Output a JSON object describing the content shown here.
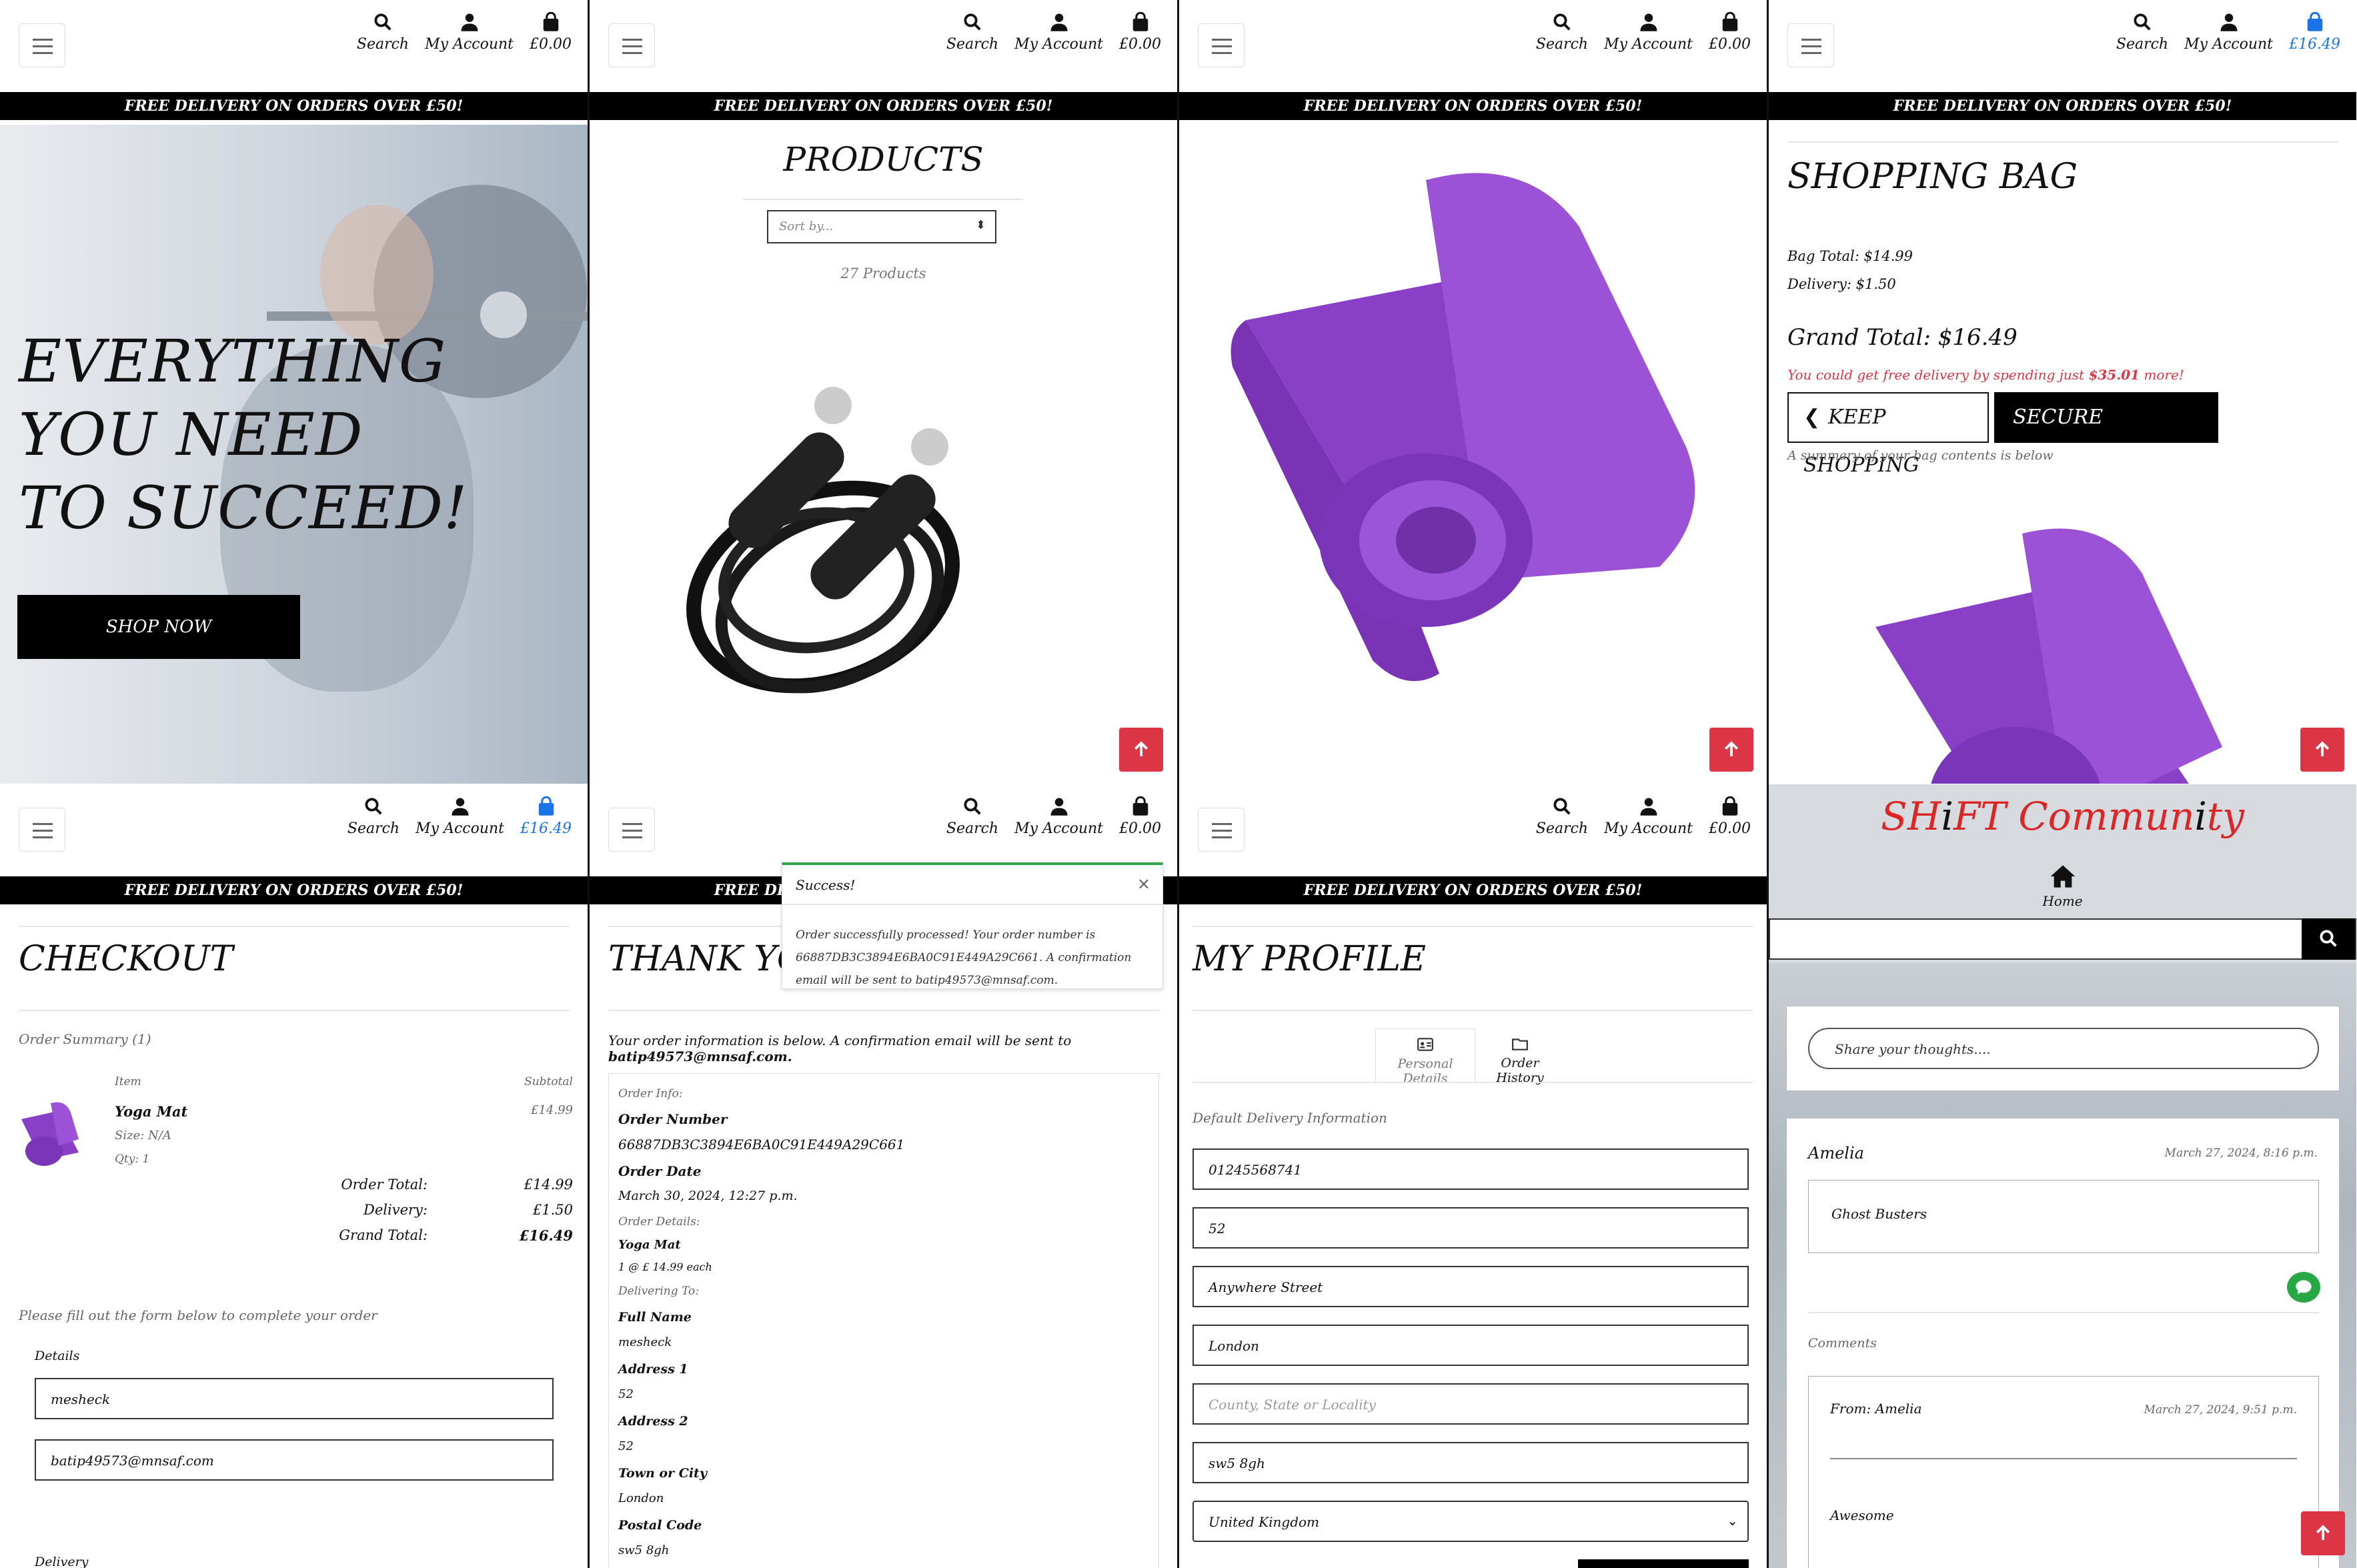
{
  "header": {
    "search_label": "Search",
    "account_label": "My Account",
    "bag_empty": "£0.00",
    "bag_filled": "£16.49",
    "banner": "FREE DELIVERY ON ORDERS OVER £50!"
  },
  "home": {
    "hero_lines": [
      "EVERYTHING",
      "YOU NEED",
      "TO SUCCEED!"
    ],
    "cta": "SHOP NOW"
  },
  "products": {
    "title": "PRODUCTS",
    "sort_placeholder": "Sort by...",
    "count": "27 Products"
  },
  "bag": {
    "title": "SHOPPING BAG",
    "bag_total": "Bag Total: $14.99",
    "delivery": "Delivery: $1.50",
    "grand_total": "Grand Total: $16.49",
    "free_delivery_prefix": "You could get free delivery by spending just ",
    "free_delivery_amount": "$35.01",
    "free_delivery_suffix": " more!",
    "keep_shopping": "KEEP SHOPPING",
    "secure_checkout": "SECURE CHECKOUT",
    "summary_note": "A summary of your bag contents is below"
  },
  "checkout": {
    "title": "CHECKOUT",
    "order_summary": "Order Summary (1)",
    "col_item": "Item",
    "col_subtotal": "Subtotal",
    "item_name": "Yoga Mat",
    "item_size": "Size: N/A",
    "item_qty": "Qty: 1",
    "item_subtotal": "£14.99",
    "order_total_label": "Order Total:",
    "order_total": "£14.99",
    "delivery_label": "Delivery:",
    "delivery": "£1.50",
    "grand_total_label": "Grand Total:",
    "grand_total": "£16.49",
    "form_note": "Please fill out the form below to complete your order",
    "details_legend": "Details",
    "name_value": "mesheck",
    "email_value": "batip49573@mnsaf.com",
    "delivery_legend": "Delivery"
  },
  "success": {
    "title": "THANK YOU",
    "toast_title": "Success!",
    "toast_text": "Order successfully processed! Your order number is 66887DB3C3894E6BA0C91E449A29C661. A confirmation email will be sent to batip49573@mnsaf.com.",
    "intro": "Your order information is below. A confirmation email will be sent to ",
    "intro_email": "batip49573@mnsaf.com.",
    "order_info": "Order Info:",
    "order_number_label": "Order Number",
    "order_number": "66887DB3C3894E6BA0C91E449A29C661",
    "order_date_label": "Order Date",
    "order_date": "March 30, 2024, 12:27 p.m.",
    "order_details": "Order Details:",
    "product": "Yoga Mat",
    "product_qty": "1 @ £ 14.99 each",
    "delivering_to": "Delivering To:",
    "full_name_label": "Full Name",
    "full_name": "mesheck",
    "address1_label": "Address 1",
    "address1": "52",
    "address2_label": "Address 2",
    "address2": "52",
    "town_label": "Town or City",
    "town": "London",
    "postcode_label": "Postal Code",
    "postcode": "sw5 8gh"
  },
  "profile": {
    "title": "MY PROFILE",
    "tab_personal": "Personal Details",
    "tab_history": "Order History",
    "section": "Default Delivery Information",
    "phone": "01245568741",
    "street1": "52",
    "street2": "Anywhere Street",
    "town": "London",
    "county_placeholder": "County, State or Locality",
    "postcode": "sw5 8gh",
    "country": "United Kingdom"
  },
  "community": {
    "title_parts": [
      "SH",
      "i",
      "FT Commun",
      "i",
      "ty"
    ],
    "home": "Home",
    "share_placeholder": "Share your thoughts....",
    "post_author": "Amelia",
    "post_date": "March 27, 2024, 8:16 p.m.",
    "post_body": "Ghost Busters",
    "comments_label": "Comments",
    "comment_from": "From: Amelia",
    "comment_date": "March 27, 2024, 9:51 p.m.",
    "comment_body": "Awesome"
  },
  "colors": {
    "accent_red": "#dc3545",
    "brand_red": "#dc2626",
    "purple": "#8a3fc7",
    "link_blue": "#1a73e8",
    "success_green": "#2ea44f"
  }
}
